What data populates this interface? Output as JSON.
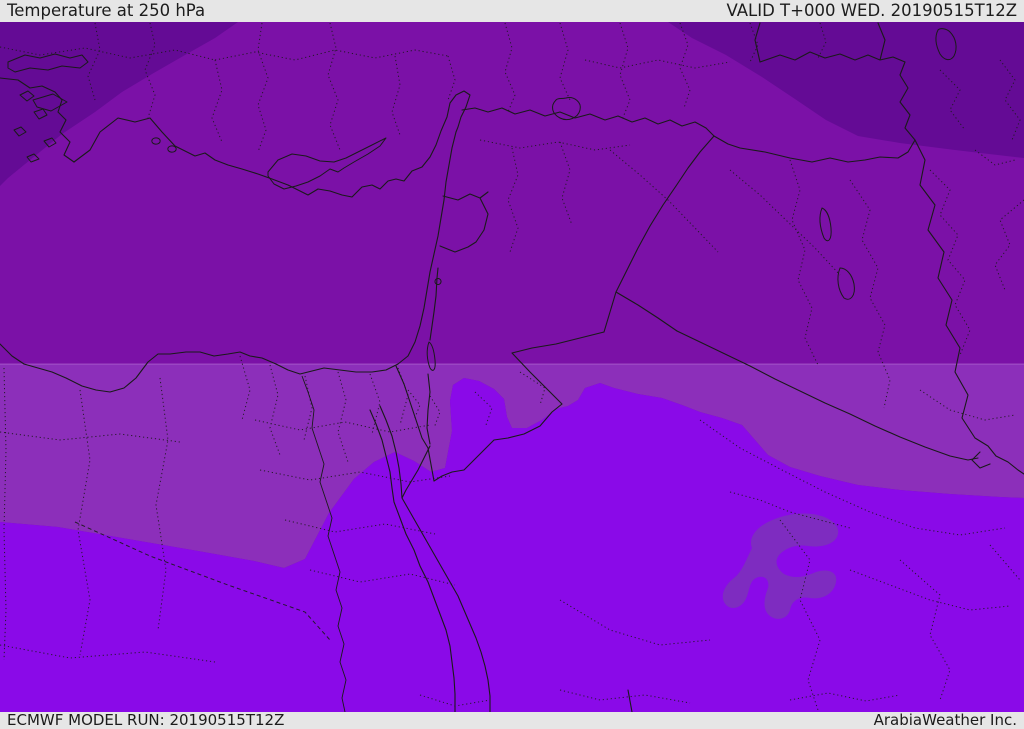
{
  "header": {
    "title": "Temperature at 250 hPa",
    "valid_label": "VALID T+000 WED. 20190515T12Z"
  },
  "footer": {
    "model_run_label": "ECMWF MODEL RUN: 20190515T12Z",
    "credit_label": "ArabiaWeather Inc."
  },
  "map": {
    "type": "weather-temperature-map",
    "parameter": "Temperature",
    "pressure_level": "250 hPa",
    "model": "ECMWF",
    "run_time": "20190515T12Z",
    "valid_step": "T+000",
    "valid_date": "WED. 20190515T12Z",
    "bands": [
      {
        "name": "coldest-band-north-corners",
        "color": "#640b95"
      },
      {
        "name": "cold-band-main",
        "color": "#7b11a7"
      },
      {
        "name": "milder-band-central",
        "color": "#8c2fba"
      },
      {
        "name": "warmest-band-south",
        "color": "#8a0ae8"
      },
      {
        "name": "cooler-island-blob",
        "color": "#7e2cc0"
      }
    ],
    "line_color": "#1a1a1a",
    "band_edge_highlight": "#deb4ef"
  },
  "colors": {
    "bar_background": "#e6e6e6",
    "bar_text": "#1c1c1c"
  }
}
